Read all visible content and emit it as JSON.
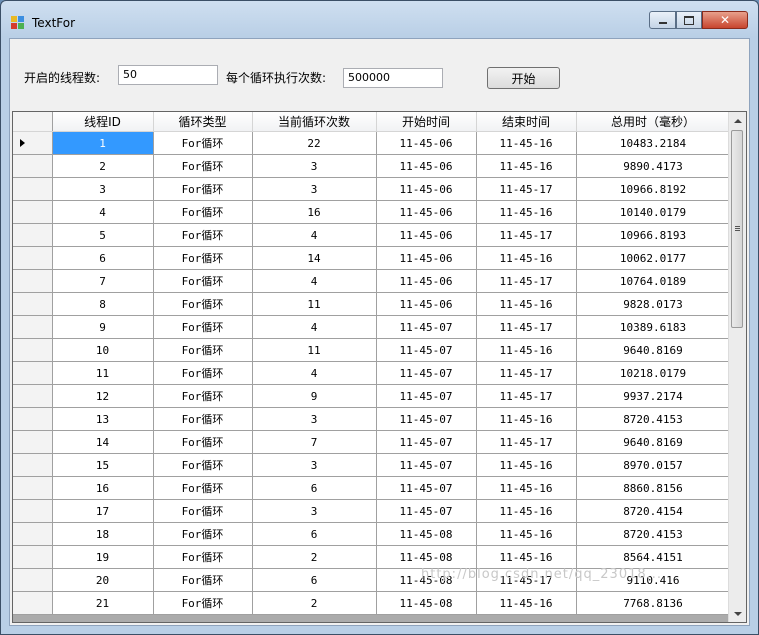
{
  "window": {
    "title": "TextFor",
    "colors": {
      "accent_selected": "#3399ff",
      "close_button": "#c8452e"
    }
  },
  "form": {
    "threads_label": "开启的线程数:",
    "threads_value": "50",
    "loops_label": "每个循环执行次数:",
    "loops_value": "500000",
    "start_button": "开始"
  },
  "grid": {
    "columns": [
      "线程ID",
      "循环类型",
      "当前循环次数",
      "开始时间",
      "结束时间",
      "总用时（毫秒）"
    ],
    "rows": [
      [
        "1",
        "For循环",
        "22",
        "11-45-06",
        "11-45-16",
        "10483.2184"
      ],
      [
        "2",
        "For循环",
        "3",
        "11-45-06",
        "11-45-16",
        "9890.4173"
      ],
      [
        "3",
        "For循环",
        "3",
        "11-45-06",
        "11-45-17",
        "10966.8192"
      ],
      [
        "4",
        "For循环",
        "16",
        "11-45-06",
        "11-45-16",
        "10140.0179"
      ],
      [
        "5",
        "For循环",
        "4",
        "11-45-06",
        "11-45-17",
        "10966.8193"
      ],
      [
        "6",
        "For循环",
        "14",
        "11-45-06",
        "11-45-16",
        "10062.0177"
      ],
      [
        "7",
        "For循环",
        "4",
        "11-45-06",
        "11-45-17",
        "10764.0189"
      ],
      [
        "8",
        "For循环",
        "11",
        "11-45-06",
        "11-45-16",
        "9828.0173"
      ],
      [
        "9",
        "For循环",
        "4",
        "11-45-07",
        "11-45-17",
        "10389.6183"
      ],
      [
        "10",
        "For循环",
        "11",
        "11-45-07",
        "11-45-16",
        "9640.8169"
      ],
      [
        "11",
        "For循环",
        "4",
        "11-45-07",
        "11-45-17",
        "10218.0179"
      ],
      [
        "12",
        "For循环",
        "9",
        "11-45-07",
        "11-45-17",
        "9937.2174"
      ],
      [
        "13",
        "For循环",
        "3",
        "11-45-07",
        "11-45-16",
        "8720.4153"
      ],
      [
        "14",
        "For循环",
        "7",
        "11-45-07",
        "11-45-17",
        "9640.8169"
      ],
      [
        "15",
        "For循环",
        "3",
        "11-45-07",
        "11-45-16",
        "8970.0157"
      ],
      [
        "16",
        "For循环",
        "6",
        "11-45-07",
        "11-45-16",
        "8860.8156"
      ],
      [
        "17",
        "For循环",
        "3",
        "11-45-07",
        "11-45-16",
        "8720.4154"
      ],
      [
        "18",
        "For循环",
        "6",
        "11-45-08",
        "11-45-16",
        "8720.4153"
      ],
      [
        "19",
        "For循环",
        "2",
        "11-45-08",
        "11-45-16",
        "8564.4151"
      ],
      [
        "20",
        "For循环",
        "6",
        "11-45-08",
        "11-45-17",
        "9110.416"
      ],
      [
        "21",
        "For循环",
        "2",
        "11-45-08",
        "11-45-16",
        "7768.8136"
      ]
    ]
  },
  "watermark": "http://blog.csdn.net/qq_23018..."
}
